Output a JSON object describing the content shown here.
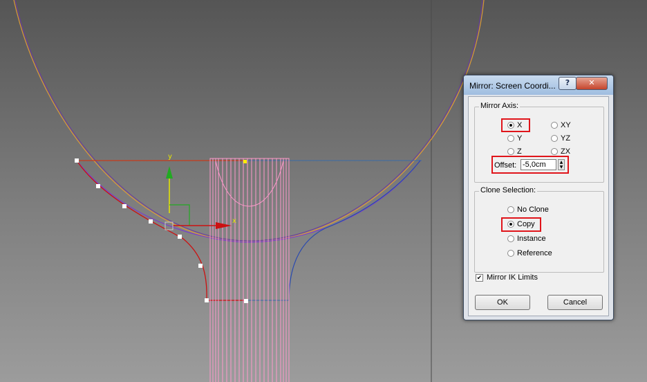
{
  "viewport": {
    "gizmo": {
      "x_label": "x",
      "y_label": "y"
    }
  },
  "dialog": {
    "title": "Mirror: Screen Coordi...",
    "help_label": "?",
    "close_label": "✕",
    "mirror_axis": {
      "title": "Mirror Axis:",
      "options": [
        "X",
        "XY",
        "Y",
        "YZ",
        "Z",
        "ZX"
      ],
      "selected": "X",
      "offset_label": "Offset:",
      "offset_value": "-5,0cm"
    },
    "clone_selection": {
      "title": "Clone Selection:",
      "options": [
        "No Clone",
        "Copy",
        "Instance",
        "Reference"
      ],
      "selected": "Copy"
    },
    "mirror_ik": {
      "label": "Mirror IK Limits",
      "checked": true
    },
    "ok_label": "OK",
    "cancel_label": "Cancel"
  },
  "colors": {
    "highlight": "#e0141a",
    "spline_selected": "#cc1111",
    "spline_pink": "#ff99cc",
    "circle": "#d99a3a"
  }
}
